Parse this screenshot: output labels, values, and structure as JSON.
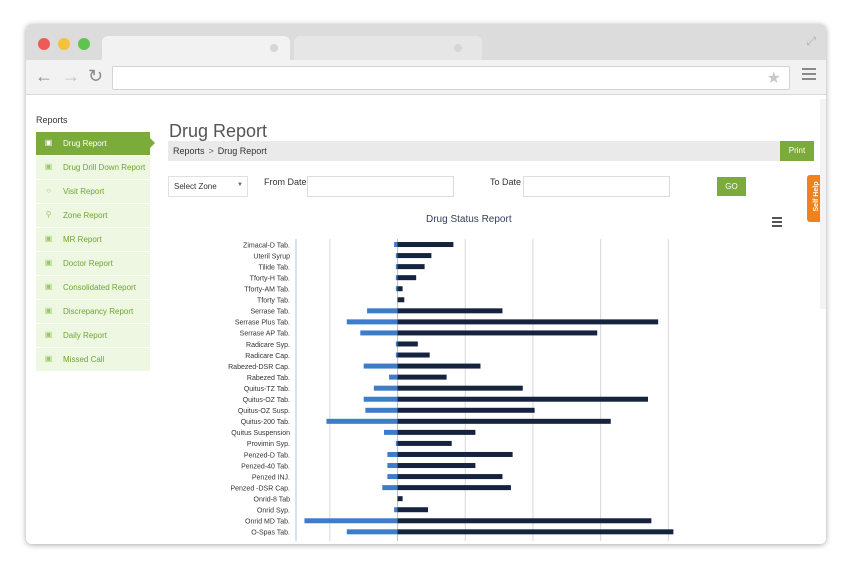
{
  "browser": {
    "dot_colors": [
      "#ee5b57",
      "#f6c13b",
      "#5dc44e"
    ]
  },
  "sidebar": {
    "title": "Reports",
    "items": [
      {
        "label": "Drug Report",
        "icon": "chart-icon",
        "active": true
      },
      {
        "label": "Drug Drill Down Report",
        "icon": "chart-icon",
        "active": false
      },
      {
        "label": "Visit Report",
        "icon": "circle-icon",
        "active": false
      },
      {
        "label": "Zone Report",
        "icon": "map-pin-icon",
        "active": false
      },
      {
        "label": "MR Report",
        "icon": "chart-icon",
        "active": false
      },
      {
        "label": "Doctor Report",
        "icon": "chart-icon",
        "active": false
      },
      {
        "label": "Consolidated Report",
        "icon": "chart-icon",
        "active": false
      },
      {
        "label": "Discrepancy Report",
        "icon": "chart-icon",
        "active": false
      },
      {
        "label": "Daily Report",
        "icon": "chart-icon",
        "active": false
      },
      {
        "label": "Missed Call",
        "icon": "chart-icon",
        "active": false
      }
    ]
  },
  "page": {
    "title": "Drug Report",
    "breadcrumb": {
      "root": "Reports",
      "separator": ">",
      "current": "Drug Report"
    },
    "print_label": "Print"
  },
  "filters": {
    "zone_select": "Select Zone",
    "from_label": "From Date",
    "to_label": "To Date",
    "go_label": "GO"
  },
  "self_help": "Self Help",
  "colors": {
    "accent": "#7aab3b",
    "series_negative": "#3d7cc9",
    "series_positive": "#16233f",
    "self_help": "#f0821e"
  },
  "chart_data": {
    "type": "bar",
    "title": "Drug Status Report",
    "orientation": "horizontal",
    "categories": [
      "Zimacal-D Tab.",
      "Uteril Syrup",
      "Tilide Tab.",
      "Tforty-H Tab.",
      "Tforty-AM Tab.",
      "Tforty Tab.",
      "Serrase Tab.",
      "Serrase Plus Tab.",
      "Serrase AP Tab.",
      "Radicare Syp.",
      "Radicare Cap.",
      "Rabezed-DSR Cap.",
      "Rabezed Tab.",
      "Quitus-TZ Tab.",
      "Quitus-OZ Tab.",
      "Quitus-OZ Susp.",
      "Quitus-200 Tab.",
      "Quitus Suspension",
      "Provimin Syp.",
      "Penzed-D Tab.",
      "Penzed-40 Tab.",
      "Penzed INJ.",
      "Penzed -DSR Cap.",
      "Onrid-8 Tab",
      "Onrid Syp.",
      "Onrid MD Tab.",
      "O-Spas Tab."
    ],
    "series": [
      {
        "values": [
          -2,
          -1,
          -1,
          -1,
          -1,
          0,
          -18,
          -30,
          -22,
          -1,
          -1,
          -20,
          -5,
          -14,
          -20,
          -19,
          -42,
          -8,
          -1,
          -6,
          -6,
          -6,
          -9,
          0,
          -2,
          -55,
          -30
        ]
      },
      {
        "values": [
          33,
          20,
          16,
          11,
          3,
          4,
          62,
          154,
          118,
          12,
          19,
          49,
          29,
          74,
          148,
          81,
          126,
          46,
          32,
          68,
          46,
          62,
          67,
          3,
          18,
          150,
          163
        ]
      }
    ],
    "xlim": [
      -60,
      200
    ],
    "grid": true,
    "legend": "none",
    "mirror_category_labels_right": true
  }
}
